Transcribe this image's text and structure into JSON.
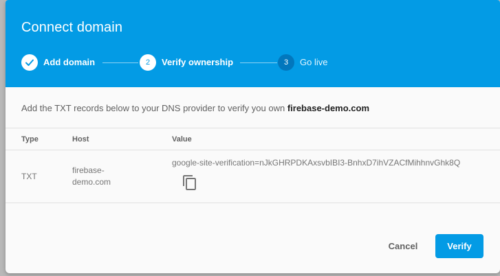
{
  "dialog": {
    "title": "Connect domain"
  },
  "stepper": {
    "steps": [
      {
        "number": "1",
        "label": "Add domain",
        "state": "done",
        "icon": "check-icon"
      },
      {
        "number": "2",
        "label": "Verify ownership",
        "state": "active"
      },
      {
        "number": "3",
        "label": "Go live",
        "state": "inactive"
      }
    ]
  },
  "instructions": {
    "text": "Add the TXT records below to your DNS provider to verify you own ",
    "domain": "firebase-demo.com"
  },
  "table": {
    "columns": [
      "Type",
      "Host",
      "Value"
    ],
    "rows": [
      {
        "type": "TXT",
        "host_line1": "firebase-",
        "host_line2": "demo.com",
        "value": "google-site-verification=nJkGHRPDKAxsvbIBI3-BnhxD7ihVZACfMihhnvGhk8Q",
        "copy_icon": "copy-icon"
      }
    ]
  },
  "actions": {
    "cancel_label": "Cancel",
    "verify_label": "Verify"
  },
  "colors": {
    "header": "#039be5",
    "primary_button": "#039be5",
    "inactive_step": "#0277bd"
  }
}
